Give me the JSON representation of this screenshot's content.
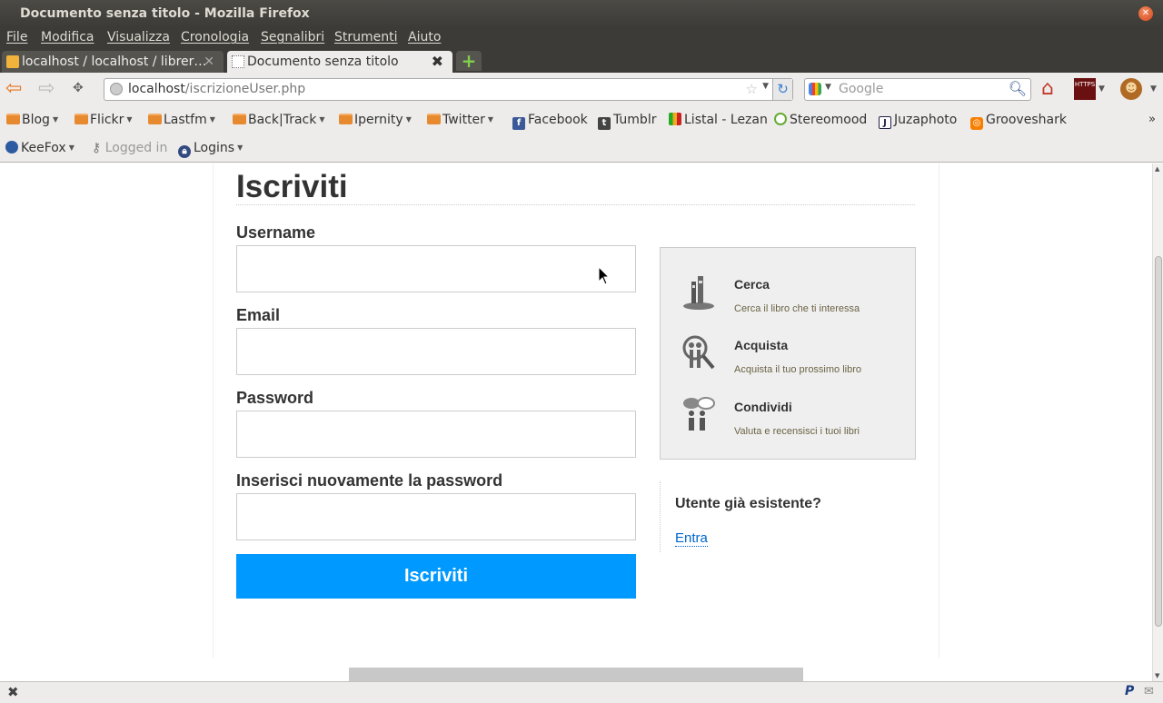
{
  "window": {
    "title": "Documento senza titolo - Mozilla Firefox"
  },
  "menu": [
    "File",
    "Modifica",
    "Visualizza",
    "Cronologia",
    "Segnalibri",
    "Strumenti",
    "Aiuto"
  ],
  "tabs": [
    {
      "label": "localhost / localhost / librer…",
      "active": false
    },
    {
      "label": "Documento senza titolo",
      "active": true
    }
  ],
  "nav": {
    "url_host": "localhost",
    "url_path": "/iscrizioneUser.php",
    "search_placeholder": "Google",
    "https_label": "HTTPS"
  },
  "bookmarks": [
    {
      "label": "Blog",
      "type": "folder"
    },
    {
      "label": "Flickr",
      "type": "folder"
    },
    {
      "label": "Lastfm",
      "type": "folder"
    },
    {
      "label": "Back|Track",
      "type": "folder"
    },
    {
      "label": "Ipernity",
      "type": "folder"
    },
    {
      "label": "Twitter",
      "type": "folder"
    },
    {
      "label": "Facebook",
      "type": "link"
    },
    {
      "label": "Tumblr",
      "type": "link"
    },
    {
      "label": "Listal - Lezan",
      "type": "link"
    },
    {
      "label": "Stereomood",
      "type": "link"
    },
    {
      "label": "Juzaphoto",
      "type": "link"
    },
    {
      "label": "Grooveshark",
      "type": "link"
    }
  ],
  "keefox": {
    "keefox": "KeeFox",
    "logged_in": "Logged in",
    "logins": "Logins"
  },
  "page": {
    "title": "Iscriviti",
    "fields": {
      "username": "Username",
      "email": "Email",
      "password": "Password",
      "password_repeat": "Inserisci nuovamente la password"
    },
    "submit": "Iscriviti",
    "features": [
      {
        "title": "Cerca",
        "desc": "Cerca il libro che ti interessa",
        "icon": "books-icon"
      },
      {
        "title": "Acquista",
        "desc": "Acquista il tuo prossimo libro",
        "icon": "magnifier-people-icon"
      },
      {
        "title": "Condividi",
        "desc": "Valuta e recensisci i tuoi libri",
        "icon": "speech-people-icon"
      }
    ],
    "existing": {
      "title": "Utente già esistente?",
      "link": "Entra"
    }
  },
  "colors": {
    "accent": "#0099ff",
    "link": "#0066cc",
    "titlebar": "#3c3b37"
  }
}
